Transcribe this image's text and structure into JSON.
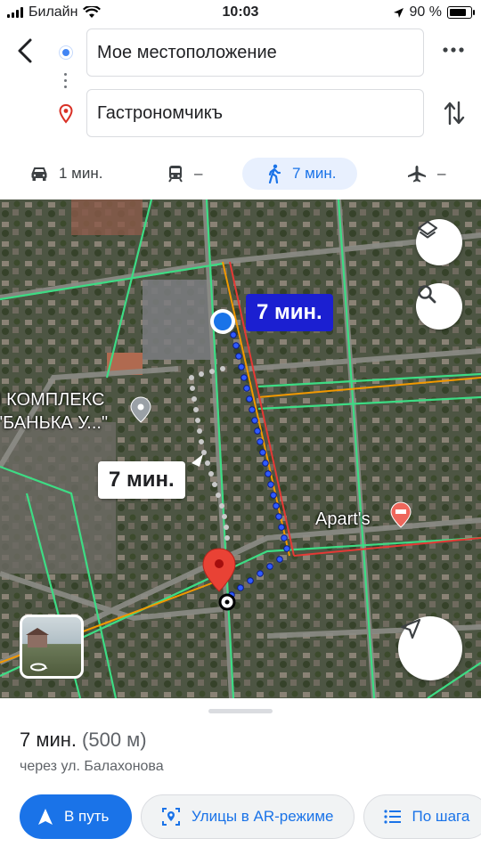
{
  "status_bar": {
    "carrier": "Билайн",
    "time": "10:03",
    "battery": "90 %"
  },
  "route": {
    "origin": "Мое местоположение",
    "destination": "Гастрономчикъ"
  },
  "icons": {
    "back": "back-arrow-icon",
    "more": "more-horizontal-icon",
    "swap": "swap-vertical-icon",
    "layers": "layers-icon",
    "search": "search-icon",
    "navigate": "navigation-arrow-icon",
    "street_view": "street-view-thumbnail"
  },
  "modes": [
    {
      "icon": "car-icon",
      "label": "1 мин.",
      "active": false
    },
    {
      "icon": "transit-icon",
      "label": "–",
      "active": false
    },
    {
      "icon": "walk-icon",
      "label": "7 мин.",
      "active": true
    },
    {
      "icon": "flight-icon",
      "label": "–",
      "active": false
    }
  ],
  "map": {
    "route_label_primary": "7 мин.",
    "route_label_alt": "7 мин.",
    "poi_complex_line1": "І КОМПЛЕКС",
    "poi_complex_line2": "\"БАНЬКА У...\"",
    "poi_hotel": "Apart's"
  },
  "summary": {
    "duration": "7 мин.",
    "distance": "(500 м)",
    "via": "через ул. Балахонова"
  },
  "actions": {
    "start": "В путь",
    "ar": "Улицы в AR-режиме",
    "steps": "По шага"
  },
  "colors": {
    "accent": "#1a73e8",
    "route": "#1b1fd1",
    "pin": "#e94235"
  }
}
